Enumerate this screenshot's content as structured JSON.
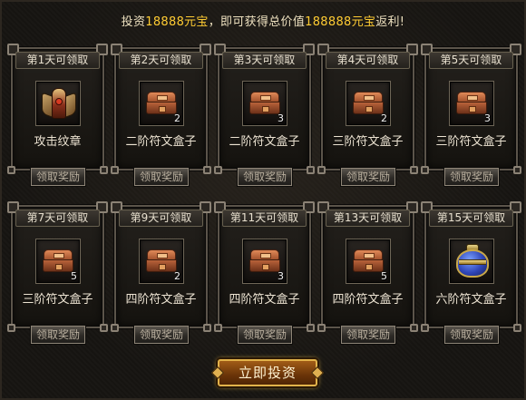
{
  "banner": {
    "prefix": "投资",
    "amount": "18888元宝",
    "middle": "，即可获得总价值",
    "total": "188888元宝",
    "suffix": "返利!"
  },
  "rewards": [
    {
      "day": "第1天可领取",
      "item": "攻击纹章",
      "icon": "badge-icon",
      "count": "",
      "button": "领取奖励"
    },
    {
      "day": "第2天可领取",
      "item": "二阶符文盒子",
      "icon": "rune-box-icon",
      "count": "2",
      "button": "领取奖励"
    },
    {
      "day": "第3天可领取",
      "item": "二阶符文盒子",
      "icon": "rune-box-icon",
      "count": "3",
      "button": "领取奖励"
    },
    {
      "day": "第4天可领取",
      "item": "三阶符文盒子",
      "icon": "rune-box-icon",
      "count": "2",
      "button": "领取奖励"
    },
    {
      "day": "第5天可领取",
      "item": "三阶符文盒子",
      "icon": "rune-box-icon",
      "count": "3",
      "button": "领取奖励"
    },
    {
      "day": "第7天可领取",
      "item": "三阶符文盒子",
      "icon": "rune-box-icon",
      "count": "5",
      "button": "领取奖励"
    },
    {
      "day": "第9天可领取",
      "item": "四阶符文盒子",
      "icon": "rune-box-icon",
      "count": "2",
      "button": "领取奖励"
    },
    {
      "day": "第11天可领取",
      "item": "四阶符文盒子",
      "icon": "rune-box-icon",
      "count": "3",
      "button": "领取奖励"
    },
    {
      "day": "第13天可领取",
      "item": "四阶符文盒子",
      "icon": "rune-box-icon",
      "count": "5",
      "button": "领取奖励"
    },
    {
      "day": "第15天可领取",
      "item": "六阶符文盒子",
      "icon": "jar-icon",
      "count": "",
      "button": "领取奖励"
    }
  ],
  "invest_button": "立即投资",
  "colors": {
    "highlight": "#ffcc33",
    "text": "#ede0bf",
    "button_gold": "#e2b24a"
  }
}
